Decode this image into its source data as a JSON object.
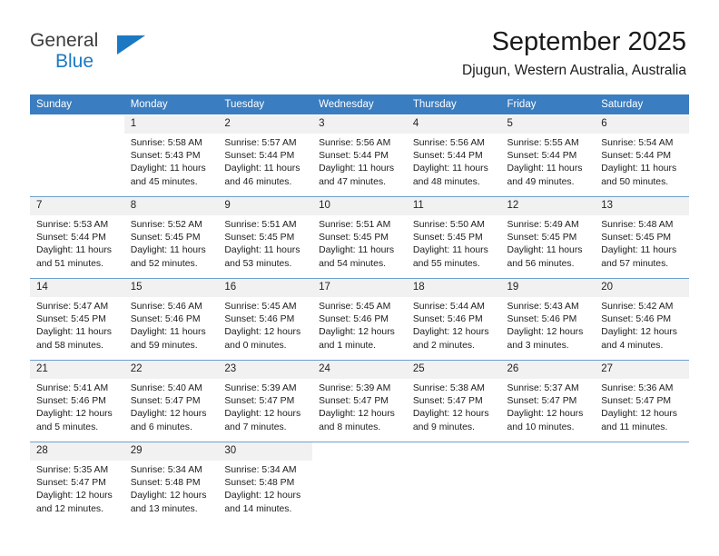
{
  "brand": {
    "name_part1": "General",
    "name_part2": "Blue",
    "logo_icon": "triangle-flag-mark",
    "accent_color": "#1b79c4"
  },
  "header": {
    "title": "September 2025",
    "subtitle": "Djugun, Western Australia, Australia"
  },
  "theme": {
    "header_row_bg": "#3a7dc0",
    "daynum_bg": "#f1f1f1",
    "row_divider": "#6e9fd0",
    "text": "#1c1c1c"
  },
  "weekdays": [
    "Sunday",
    "Monday",
    "Tuesday",
    "Wednesday",
    "Thursday",
    "Friday",
    "Saturday"
  ],
  "weeks": [
    [
      {
        "day": "",
        "sunrise": "",
        "sunset": "",
        "daylight_line1": "",
        "daylight_line2": ""
      },
      {
        "day": "1",
        "sunrise": "Sunrise: 5:58 AM",
        "sunset": "Sunset: 5:43 PM",
        "daylight_line1": "Daylight: 11 hours",
        "daylight_line2": "and 45 minutes."
      },
      {
        "day": "2",
        "sunrise": "Sunrise: 5:57 AM",
        "sunset": "Sunset: 5:44 PM",
        "daylight_line1": "Daylight: 11 hours",
        "daylight_line2": "and 46 minutes."
      },
      {
        "day": "3",
        "sunrise": "Sunrise: 5:56 AM",
        "sunset": "Sunset: 5:44 PM",
        "daylight_line1": "Daylight: 11 hours",
        "daylight_line2": "and 47 minutes."
      },
      {
        "day": "4",
        "sunrise": "Sunrise: 5:56 AM",
        "sunset": "Sunset: 5:44 PM",
        "daylight_line1": "Daylight: 11 hours",
        "daylight_line2": "and 48 minutes."
      },
      {
        "day": "5",
        "sunrise": "Sunrise: 5:55 AM",
        "sunset": "Sunset: 5:44 PM",
        "daylight_line1": "Daylight: 11 hours",
        "daylight_line2": "and 49 minutes."
      },
      {
        "day": "6",
        "sunrise": "Sunrise: 5:54 AM",
        "sunset": "Sunset: 5:44 PM",
        "daylight_line1": "Daylight: 11 hours",
        "daylight_line2": "and 50 minutes."
      }
    ],
    [
      {
        "day": "7",
        "sunrise": "Sunrise: 5:53 AM",
        "sunset": "Sunset: 5:44 PM",
        "daylight_line1": "Daylight: 11 hours",
        "daylight_line2": "and 51 minutes."
      },
      {
        "day": "8",
        "sunrise": "Sunrise: 5:52 AM",
        "sunset": "Sunset: 5:45 PM",
        "daylight_line1": "Daylight: 11 hours",
        "daylight_line2": "and 52 minutes."
      },
      {
        "day": "9",
        "sunrise": "Sunrise: 5:51 AM",
        "sunset": "Sunset: 5:45 PM",
        "daylight_line1": "Daylight: 11 hours",
        "daylight_line2": "and 53 minutes."
      },
      {
        "day": "10",
        "sunrise": "Sunrise: 5:51 AM",
        "sunset": "Sunset: 5:45 PM",
        "daylight_line1": "Daylight: 11 hours",
        "daylight_line2": "and 54 minutes."
      },
      {
        "day": "11",
        "sunrise": "Sunrise: 5:50 AM",
        "sunset": "Sunset: 5:45 PM",
        "daylight_line1": "Daylight: 11 hours",
        "daylight_line2": "and 55 minutes."
      },
      {
        "day": "12",
        "sunrise": "Sunrise: 5:49 AM",
        "sunset": "Sunset: 5:45 PM",
        "daylight_line1": "Daylight: 11 hours",
        "daylight_line2": "and 56 minutes."
      },
      {
        "day": "13",
        "sunrise": "Sunrise: 5:48 AM",
        "sunset": "Sunset: 5:45 PM",
        "daylight_line1": "Daylight: 11 hours",
        "daylight_line2": "and 57 minutes."
      }
    ],
    [
      {
        "day": "14",
        "sunrise": "Sunrise: 5:47 AM",
        "sunset": "Sunset: 5:45 PM",
        "daylight_line1": "Daylight: 11 hours",
        "daylight_line2": "and 58 minutes."
      },
      {
        "day": "15",
        "sunrise": "Sunrise: 5:46 AM",
        "sunset": "Sunset: 5:46 PM",
        "daylight_line1": "Daylight: 11 hours",
        "daylight_line2": "and 59 minutes."
      },
      {
        "day": "16",
        "sunrise": "Sunrise: 5:45 AM",
        "sunset": "Sunset: 5:46 PM",
        "daylight_line1": "Daylight: 12 hours",
        "daylight_line2": "and 0 minutes."
      },
      {
        "day": "17",
        "sunrise": "Sunrise: 5:45 AM",
        "sunset": "Sunset: 5:46 PM",
        "daylight_line1": "Daylight: 12 hours",
        "daylight_line2": "and 1 minute."
      },
      {
        "day": "18",
        "sunrise": "Sunrise: 5:44 AM",
        "sunset": "Sunset: 5:46 PM",
        "daylight_line1": "Daylight: 12 hours",
        "daylight_line2": "and 2 minutes."
      },
      {
        "day": "19",
        "sunrise": "Sunrise: 5:43 AM",
        "sunset": "Sunset: 5:46 PM",
        "daylight_line1": "Daylight: 12 hours",
        "daylight_line2": "and 3 minutes."
      },
      {
        "day": "20",
        "sunrise": "Sunrise: 5:42 AM",
        "sunset": "Sunset: 5:46 PM",
        "daylight_line1": "Daylight: 12 hours",
        "daylight_line2": "and 4 minutes."
      }
    ],
    [
      {
        "day": "21",
        "sunrise": "Sunrise: 5:41 AM",
        "sunset": "Sunset: 5:46 PM",
        "daylight_line1": "Daylight: 12 hours",
        "daylight_line2": "and 5 minutes."
      },
      {
        "day": "22",
        "sunrise": "Sunrise: 5:40 AM",
        "sunset": "Sunset: 5:47 PM",
        "daylight_line1": "Daylight: 12 hours",
        "daylight_line2": "and 6 minutes."
      },
      {
        "day": "23",
        "sunrise": "Sunrise: 5:39 AM",
        "sunset": "Sunset: 5:47 PM",
        "daylight_line1": "Daylight: 12 hours",
        "daylight_line2": "and 7 minutes."
      },
      {
        "day": "24",
        "sunrise": "Sunrise: 5:39 AM",
        "sunset": "Sunset: 5:47 PM",
        "daylight_line1": "Daylight: 12 hours",
        "daylight_line2": "and 8 minutes."
      },
      {
        "day": "25",
        "sunrise": "Sunrise: 5:38 AM",
        "sunset": "Sunset: 5:47 PM",
        "daylight_line1": "Daylight: 12 hours",
        "daylight_line2": "and 9 minutes."
      },
      {
        "day": "26",
        "sunrise": "Sunrise: 5:37 AM",
        "sunset": "Sunset: 5:47 PM",
        "daylight_line1": "Daylight: 12 hours",
        "daylight_line2": "and 10 minutes."
      },
      {
        "day": "27",
        "sunrise": "Sunrise: 5:36 AM",
        "sunset": "Sunset: 5:47 PM",
        "daylight_line1": "Daylight: 12 hours",
        "daylight_line2": "and 11 minutes."
      }
    ],
    [
      {
        "day": "28",
        "sunrise": "Sunrise: 5:35 AM",
        "sunset": "Sunset: 5:47 PM",
        "daylight_line1": "Daylight: 12 hours",
        "daylight_line2": "and 12 minutes."
      },
      {
        "day": "29",
        "sunrise": "Sunrise: 5:34 AM",
        "sunset": "Sunset: 5:48 PM",
        "daylight_line1": "Daylight: 12 hours",
        "daylight_line2": "and 13 minutes."
      },
      {
        "day": "30",
        "sunrise": "Sunrise: 5:34 AM",
        "sunset": "Sunset: 5:48 PM",
        "daylight_line1": "Daylight: 12 hours",
        "daylight_line2": "and 14 minutes."
      },
      {
        "day": "",
        "sunrise": "",
        "sunset": "",
        "daylight_line1": "",
        "daylight_line2": ""
      },
      {
        "day": "",
        "sunrise": "",
        "sunset": "",
        "daylight_line1": "",
        "daylight_line2": ""
      },
      {
        "day": "",
        "sunrise": "",
        "sunset": "",
        "daylight_line1": "",
        "daylight_line2": ""
      },
      {
        "day": "",
        "sunrise": "",
        "sunset": "",
        "daylight_line1": "",
        "daylight_line2": ""
      }
    ]
  ]
}
